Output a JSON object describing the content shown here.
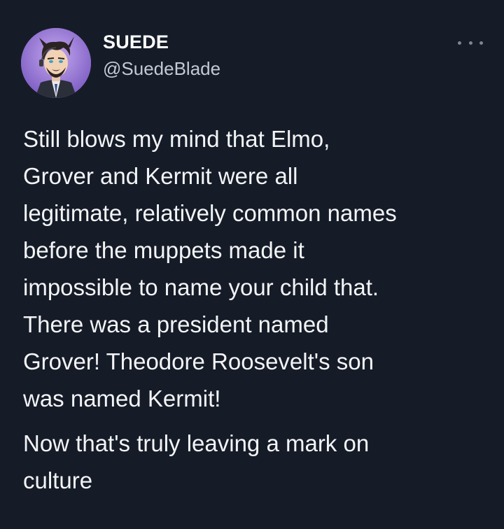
{
  "author": {
    "display_name": "SUEDE",
    "handle": "@SuedeBlade",
    "avatar_icon": "avatar-cartoon-man-icon"
  },
  "menu": {
    "more_icon": "more-options-icon"
  },
  "tweet": {
    "paragraph1_lines": [
      "Still blows my mind that Elmo,",
      "Grover and Kermit were all",
      "legitimate, relatively common names",
      "before the muppets made it",
      "impossible to name your child that.",
      "There was a president named",
      "Grover! Theodore Roosevelt's son",
      "was named Kermit!"
    ],
    "paragraph2_lines": [
      "Now that's truly leaving a mark on",
      "culture"
    ]
  },
  "colors": {
    "background": "#151c28",
    "text": "#f3f4f6",
    "handle": "#c3cad3",
    "avatar_bg": "#9a7bd6"
  }
}
